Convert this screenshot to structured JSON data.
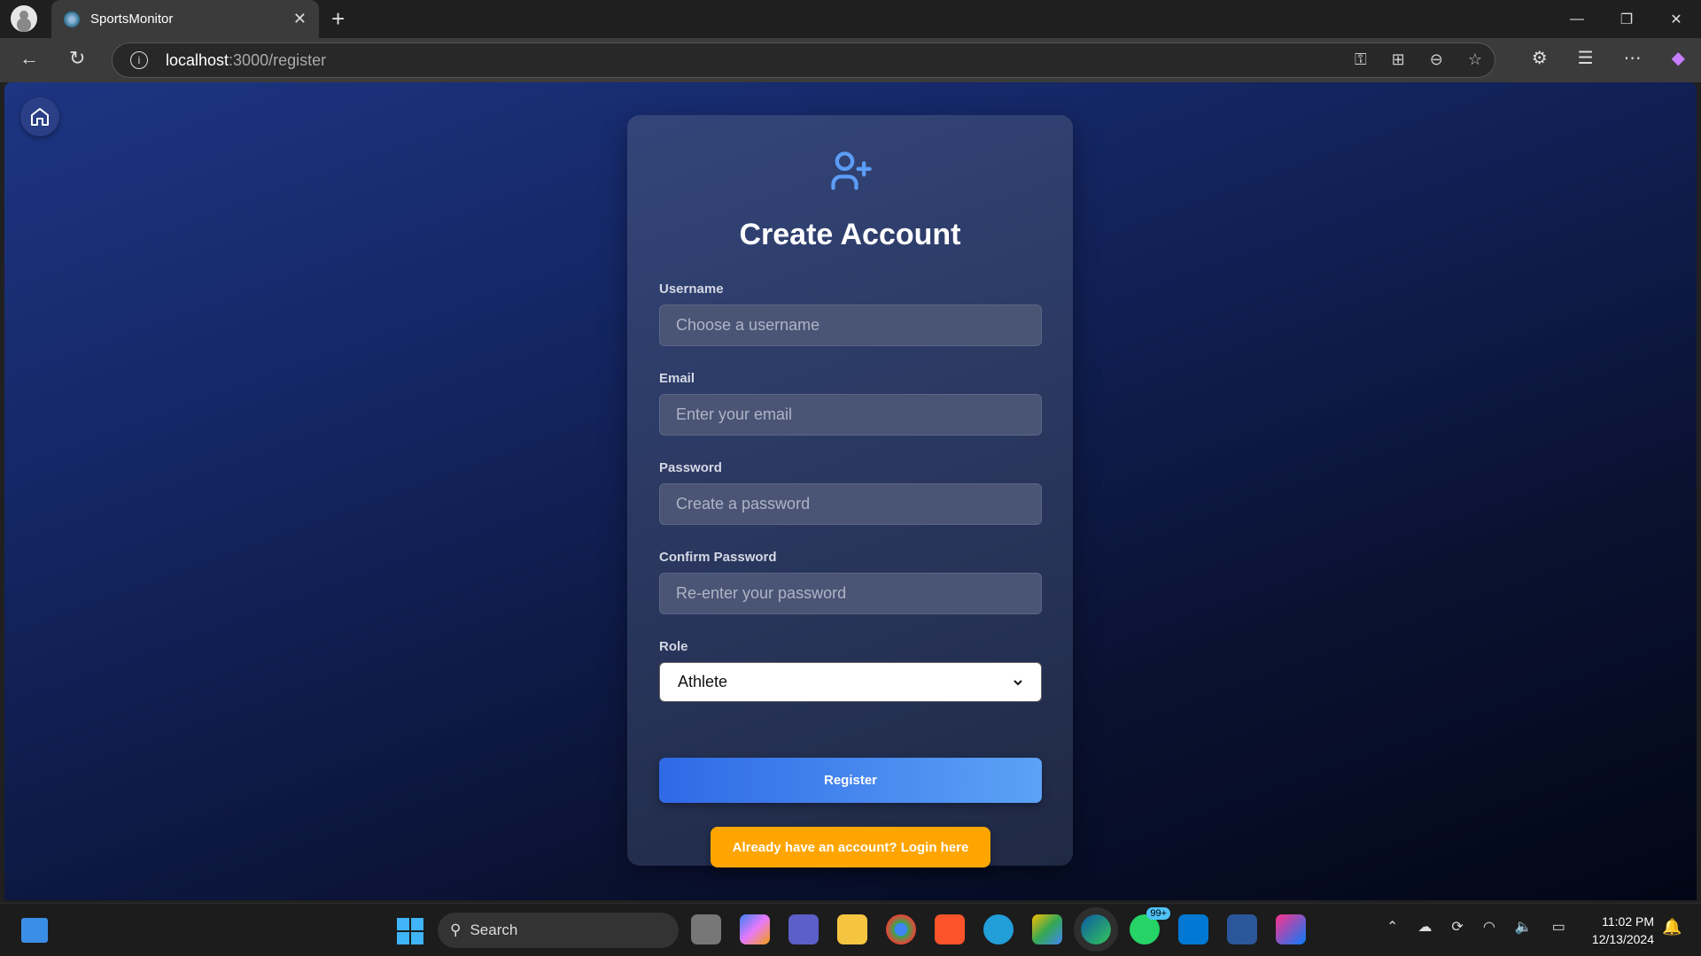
{
  "browser": {
    "tab_title": "SportsMonitor",
    "url_host": "localhost",
    "url_rest": ":3000/register"
  },
  "form": {
    "title": "Create Account",
    "fields": [
      {
        "label": "Username",
        "placeholder": "Choose a username",
        "value": ""
      },
      {
        "label": "Email",
        "placeholder": "Enter your email",
        "value": ""
      },
      {
        "label": "Password",
        "placeholder": "Create a password",
        "value": ""
      },
      {
        "label": "Confirm Password",
        "placeholder": "Re-enter your password",
        "value": ""
      }
    ],
    "role": {
      "label": "Role",
      "selected": "Athlete"
    },
    "register_label": "Register",
    "login_label": "Already have an account? Login here"
  },
  "taskbar": {
    "search_label": "Search",
    "whatsapp_badge": "99+",
    "time": "11:02 PM",
    "date": "12/13/2024"
  },
  "colors": {
    "accent": "#3b82f6",
    "login": "#ffa500",
    "icon": "#5b9cf5"
  }
}
